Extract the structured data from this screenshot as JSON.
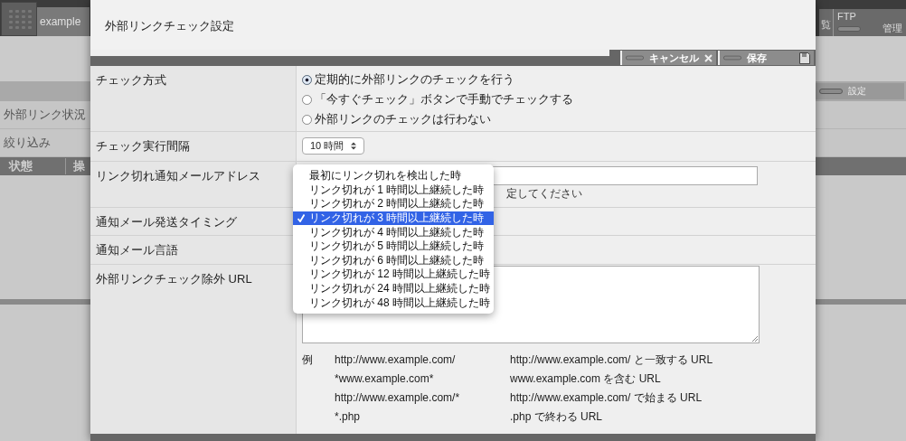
{
  "background_app": {
    "site_tab": "example",
    "list_tab": "覧",
    "ftp_tab": {
      "title": "FTP",
      "label": "管理"
    },
    "settings_button": "設定",
    "side_items": [
      "外部リンク状況",
      "絞り込み"
    ],
    "table_columns": [
      "状態",
      "操"
    ]
  },
  "dialog": {
    "title": "外部リンクチェック設定",
    "buttons": [
      {
        "label": "キャンセル",
        "kind": "cancel"
      },
      {
        "label": "保存",
        "kind": "save"
      }
    ],
    "rows": [
      {
        "kind": "radio",
        "label": "チェック方式",
        "options": [
          {
            "label": "定期的に外部リンクのチェックを行う",
            "selected": true
          },
          {
            "label": "「今すぐチェック」ボタンで手動でチェックする",
            "selected": false
          },
          {
            "label": "外部リンクのチェックは行わない",
            "selected": false
          }
        ]
      },
      {
        "kind": "select",
        "label": "チェック実行間隔",
        "value": "10 時間"
      },
      {
        "kind": "email",
        "label": "リンク切れ通知メールアドレス",
        "hint": "定してください"
      },
      {
        "kind": "dropdown",
        "label": "通知メール発送タイミング",
        "options": [
          {
            "label": "最初にリンク切れを検出した時",
            "selected": false
          },
          {
            "label": "リンク切れが 1 時間以上継続した時",
            "selected": false
          },
          {
            "label": "リンク切れが 2 時間以上継続した時",
            "selected": false
          },
          {
            "label": "リンク切れが 3 時間以上継続した時",
            "selected": true
          },
          {
            "label": "リンク切れが 4 時間以上継続した時",
            "selected": false
          },
          {
            "label": "リンク切れが 5 時間以上継続した時",
            "selected": false
          },
          {
            "label": "リンク切れが 6 時間以上継続した時",
            "selected": false
          },
          {
            "label": "リンク切れが 12 時間以上継続した時",
            "selected": false
          },
          {
            "label": "リンク切れが 24 時間以上継続した時",
            "selected": false
          },
          {
            "label": "リンク切れが 48 時間以上継続した時",
            "selected": false
          }
        ]
      },
      {
        "kind": "blank",
        "label": "通知メール言語"
      },
      {
        "kind": "urls",
        "label": "外部リンクチェック除外 URL",
        "example_label": "例",
        "examples": [
          {
            "pattern": "http://www.example.com/",
            "meaning": "http://www.example.com/ と一致する URL"
          },
          {
            "pattern": "*www.example.com*",
            "meaning": "www.example.com を含む URL"
          },
          {
            "pattern": "http://www.example.com/*",
            "meaning": "http://www.example.com/ で始まる URL"
          },
          {
            "pattern": "*.php",
            "meaning": ".php で終わる URL"
          }
        ]
      }
    ]
  }
}
